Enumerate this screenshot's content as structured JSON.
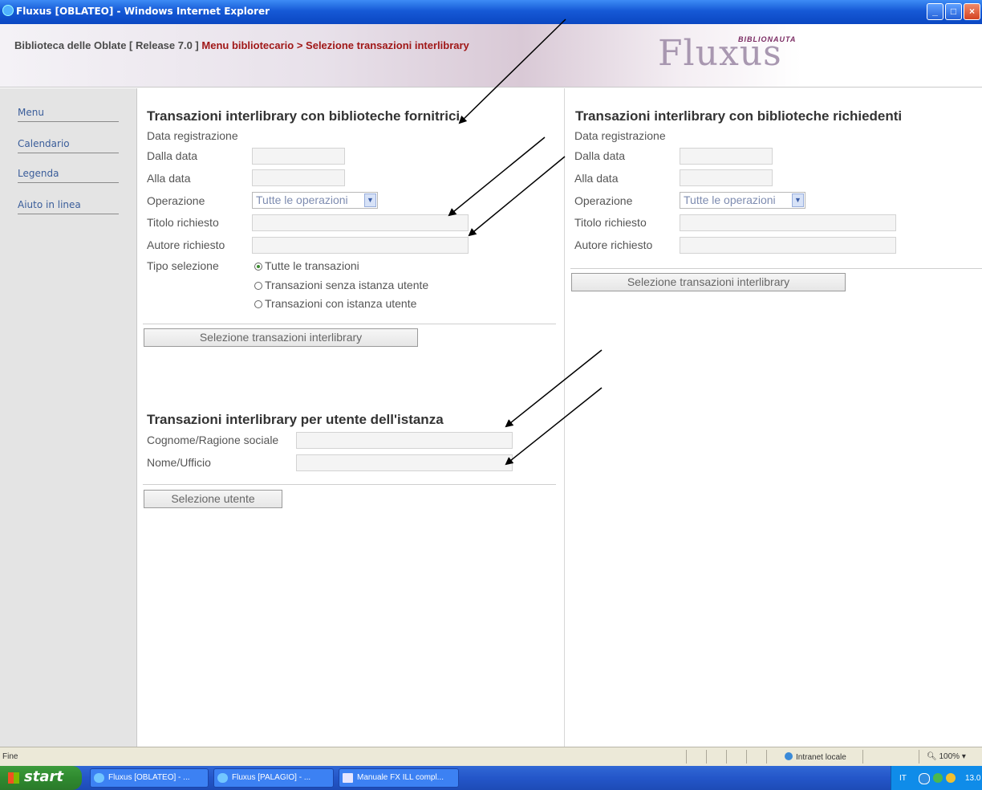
{
  "window": {
    "title": "Fluxus [OBLATEO] - Windows Internet Explorer"
  },
  "header": {
    "library": "Biblioteca delle Oblate [ Release 7.0 ]",
    "menu_path": "Menu bibliotecario > Selezione transazioni interlibrary",
    "logo": "Fluxus",
    "logo_sub": "BIBLIONAUTA"
  },
  "sidebar": {
    "items": [
      {
        "label": "Menu"
      },
      {
        "label": "Calendario"
      },
      {
        "label": "Legenda"
      },
      {
        "label": "Aiuto in linea"
      }
    ]
  },
  "providers": {
    "title": "Transazioni interlibrary con biblioteche fornitrici",
    "date_reg": "Data registrazione",
    "from_date": "Dalla data",
    "to_date": "Alla data",
    "operation": "Operazione",
    "operation_value": "Tutte le operazioni",
    "title_requested": "Titolo richiesto",
    "author_requested": "Autore richiesto",
    "selection_type": "Tipo selezione",
    "radios": [
      "Tutte le transazioni",
      "Transazioni senza istanza utente",
      "Transazioni con istanza utente"
    ],
    "button": "Selezione transazioni interlibrary"
  },
  "requesters": {
    "title": "Transazioni interlibrary con biblioteche richiedenti",
    "date_reg": "Data registrazione",
    "from_date": "Dalla data",
    "to_date": "Alla data",
    "operation": "Operazione",
    "operation_value": "Tutte le operazioni",
    "title_requested": "Titolo richiesto",
    "author_requested": "Autore richiesto",
    "button": "Selezione transazioni interlibrary"
  },
  "user": {
    "title": "Transazioni interlibrary per utente dell'istanza",
    "surname": "Cognome/Ragione sociale",
    "name": "Nome/Ufficio",
    "button": "Selezione utente"
  },
  "statusbar": {
    "status": "Fine",
    "zone": "Intranet locale",
    "zoom": "100%"
  },
  "taskbar": {
    "start": "start",
    "tasks": [
      "Fluxus [OBLATEO] - ...",
      "Fluxus [PALAGIO] - ...",
      "Manuale FX ILL compl..."
    ],
    "lang": "IT",
    "time": "13.0"
  }
}
